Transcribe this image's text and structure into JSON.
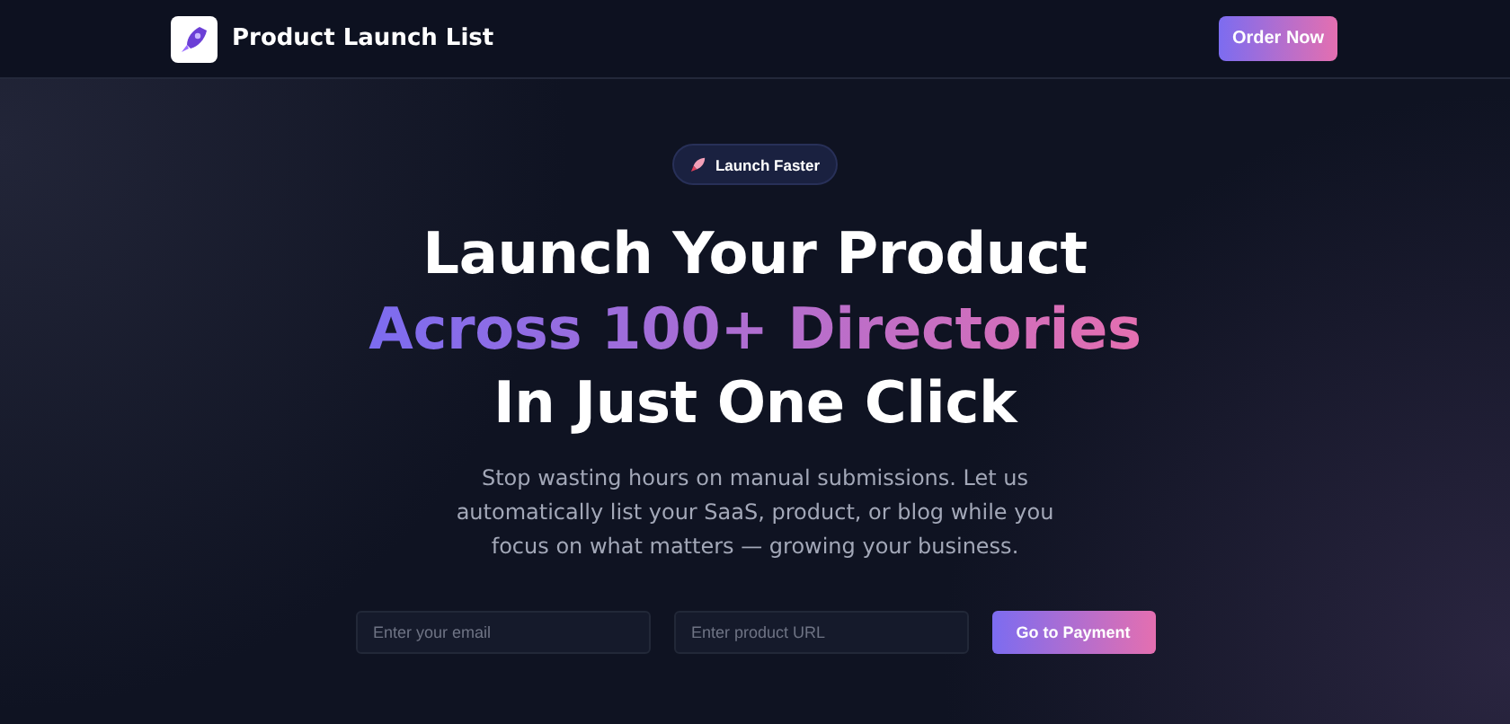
{
  "header": {
    "brand": "Product Launch List",
    "cta": "Order Now"
  },
  "hero": {
    "badge": "Launch Faster",
    "headline": [
      {
        "text": "Launch Your Product",
        "kind": "plain"
      },
      {
        "text": "Across 100+ Directories",
        "kind": "gradient"
      },
      {
        "text": "In Just One Click",
        "kind": "plain"
      }
    ],
    "description": "Stop wasting hours on manual submissions. Let us automatically list your SaaS, product, or blog while you focus on what matters — growing your business.",
    "form": {
      "email_placeholder": "Enter your email",
      "url_placeholder": "Enter product URL",
      "submit": "Go to Payment"
    }
  }
}
